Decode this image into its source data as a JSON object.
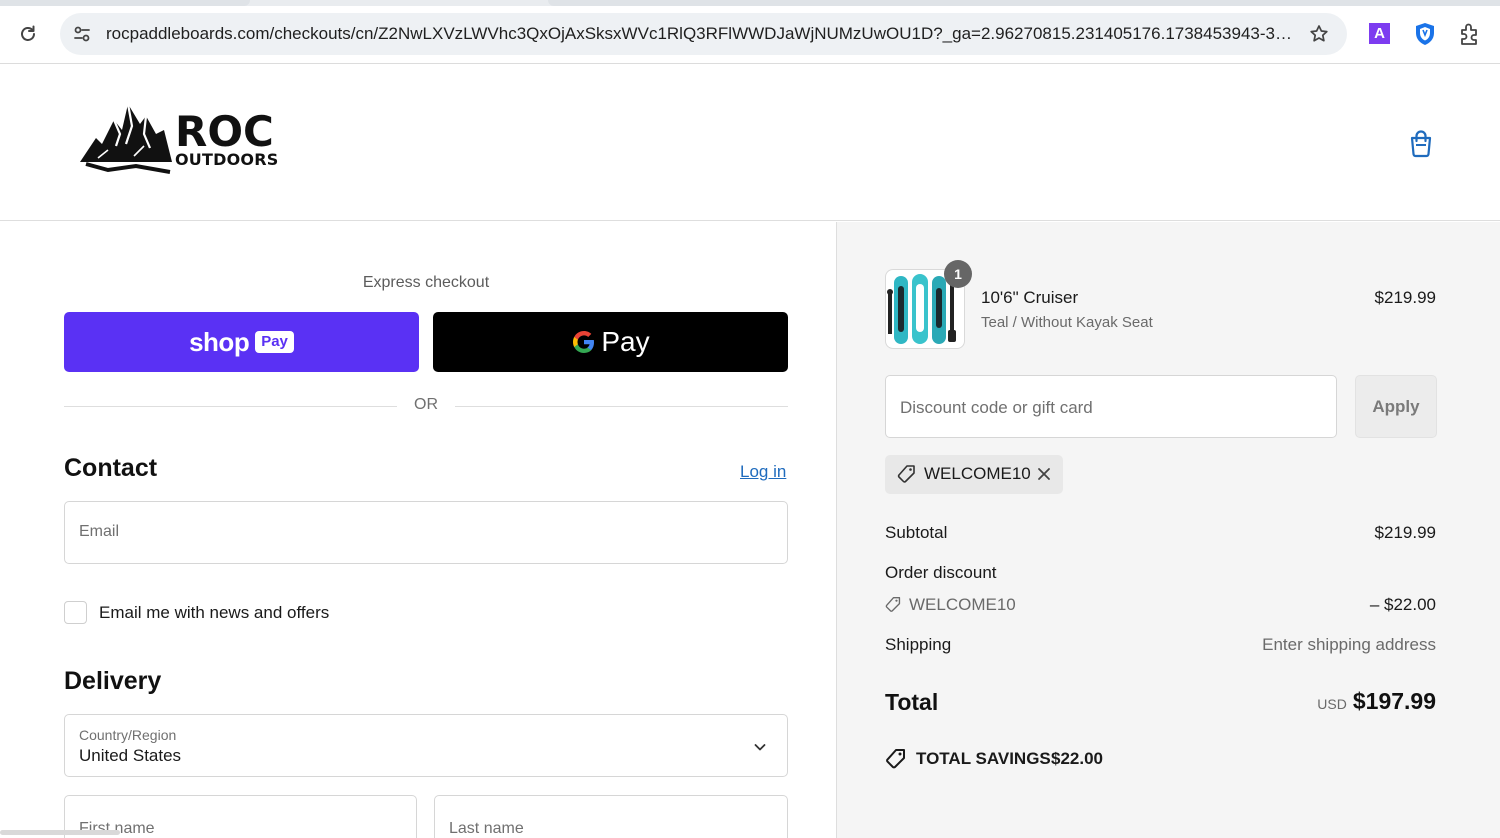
{
  "browser": {
    "url": "rocpaddleboards.com/checkouts/cn/Z2NwLXVzLWVhc3QxOjAxSksxWVc1RlQ3RFlWWDJaWjNUMzUwOU1D?_ga=2.96270815.231405176.1738453943-38...",
    "extension_letter": "A",
    "icons": {
      "reload": "reload-icon",
      "site_info": "site-settings-icon",
      "bookmark": "star-icon",
      "shield": "shield-extension-icon",
      "puzzle": "extensions-puzzle-icon"
    }
  },
  "header": {
    "logo_word": "ROC",
    "logo_sub": "OUTDOORS",
    "cart_icon": "shopping-bag-icon"
  },
  "checkout": {
    "express_title": "Express checkout",
    "shop_pay": {
      "word": "shop",
      "pill": "Pay"
    },
    "gpay": {
      "word": "Pay"
    },
    "or_text": "OR",
    "contact_title": "Contact",
    "login_label": "Log in",
    "email_placeholder": "Email",
    "news_label": "Email me with news and offers",
    "news_checked": false,
    "delivery_title": "Delivery",
    "country_caption": "Country/Region",
    "country_value": "United States",
    "first_name_placeholder": "First name",
    "last_name_placeholder": "Last name"
  },
  "summary": {
    "item": {
      "name": "10'6\" Cruiser",
      "variant": "Teal / Without Kayak Seat",
      "price": "$219.99",
      "quantity": "1"
    },
    "discount_placeholder": "Discount code or gift card",
    "apply_label": "Apply",
    "applied_code": "WELCOME10",
    "subtotal_label": "Subtotal",
    "subtotal_value": "$219.99",
    "order_discount_label": "Order discount",
    "discount_code": "WELCOME10",
    "discount_amount": "– $22.00",
    "shipping_label": "Shipping",
    "shipping_value": "Enter shipping address",
    "total_label": "Total",
    "total_currency": "USD",
    "total_amount": "$197.99",
    "savings_label": "TOTAL SAVINGS",
    "savings_amount": "$22.00"
  },
  "colors": {
    "shop_pay": "#5a31f4",
    "gpay": "#000000",
    "link": "#1f6bbd",
    "summary_bg": "#f5f5f5",
    "cart_icon": "#1f6bbd"
  }
}
